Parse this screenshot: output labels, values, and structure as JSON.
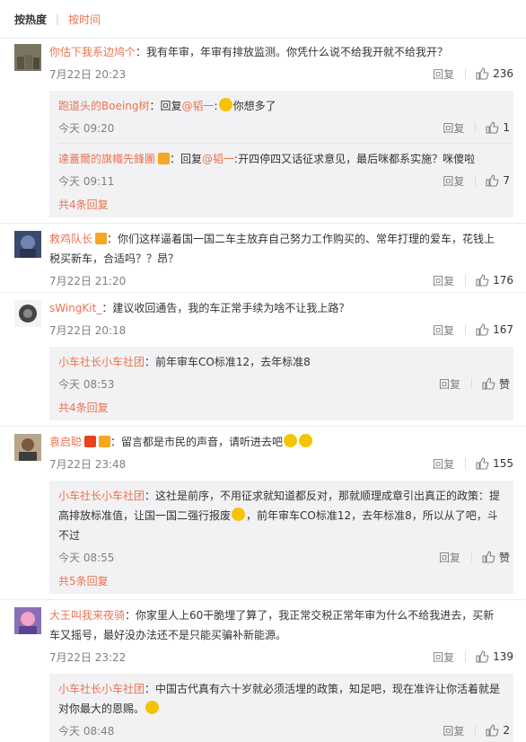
{
  "sort": {
    "hot": "按热度",
    "time": "按时间"
  },
  "comments": [
    {
      "user": "你估下我系边鸠个",
      "text": "：我有年审，年审有排放监测。你凭什么说不给我开就不给我开？",
      "time": "7月22日 20:23",
      "reply": "回复",
      "likes": "236",
      "subs": [
        {
          "user": "跑道头的Boeing树",
          "text1": "：回复",
          "at": "@韬一",
          "text2": ":",
          "text3": "你想多了",
          "time": "今天 09:20",
          "reply": "回复",
          "likes": "1"
        },
        {
          "user": "達蓋爾的旗幟先鋒團",
          "text1": "：回复",
          "at": "@韬一",
          "text2": ":开四停四又话征求意见，最后咪都系实施？咪傻啦",
          "time": "今天 09:11",
          "reply": "回复",
          "likes": "7"
        }
      ],
      "more": "共4条回复"
    },
    {
      "user": "救鸡队长",
      "text": "：你们这样逼着国一国二车主放弃自己努力工作购买的、常年打理的爱车，花钱上税买新车，合适吗？？昂？",
      "time": "7月22日 21:20",
      "reply": "回复",
      "likes": "176"
    },
    {
      "user": "sWingKit_",
      "text": "：建议收回通告，我的车正常手续为啥不让我上路？",
      "time": "7月22日 20:18",
      "reply": "回复",
      "likes": "167",
      "subs": [
        {
          "user": "小车社长小车社团",
          "text1": "：前年审车CO标准12，去年标准8",
          "time": "今天 08:53",
          "reply": "回复",
          "likes": "赞"
        }
      ],
      "more": "共4条回复"
    },
    {
      "user": "袁启聪",
      "text": "：留言都是市民的声音，请听进去吧",
      "time": "7月22日 23:48",
      "reply": "回复",
      "likes": "155",
      "subs": [
        {
          "user": "小车社长小车社团",
          "text1": "：这社是前序，不用征求就知道都反对，那就顺理成章引出真正的政策：提高排放标准值，让国一国二强行报废",
          "text2": "，前年审车CO标准12，去年标准8，所以从了吧，斗不过",
          "time": "今天 08:55",
          "reply": "回复",
          "likes": "赞"
        }
      ],
      "more": "共5条回复"
    },
    {
      "user": "大王叫我来夜骑",
      "text": "：你家里人上60干脆埋了算了，我正常交税正常年审为什么不给我进去，买新车又摇号，最好没办法还不是只能买骗补新能源。",
      "time": "7月22日 23:22",
      "reply": "回复",
      "likes": "139",
      "subs": [
        {
          "user": "小车社长小车社团",
          "text1": "：中国古代真有六十岁就必须活埋的政策，知足吧，现在准许让你活着就是对你最大的恩赐。",
          "time": "今天 08:48",
          "reply": "回复",
          "likes": "2"
        }
      ]
    }
  ],
  "colors": {
    "accent": "#eb7350",
    "sub_bg": "#f2f2f5"
  }
}
